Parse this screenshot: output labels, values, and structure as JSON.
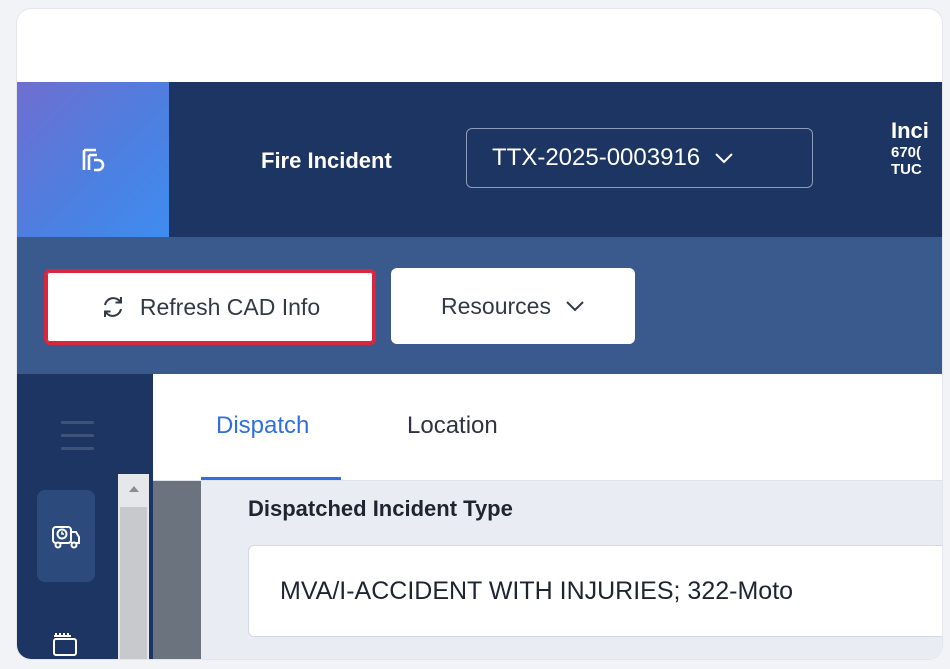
{
  "header": {
    "page_title": "Fire Incident",
    "incident_number": "TTX-2025-0003916",
    "incident_info": {
      "line1": "Inci",
      "line2": "670(",
      "line3": "TUC"
    }
  },
  "toolbar": {
    "refresh_label": "Refresh CAD Info",
    "resources_label": "Resources"
  },
  "tabs": {
    "dispatch": "Dispatch",
    "location": "Location"
  },
  "form": {
    "dispatched_type_label": "Dispatched Incident Type",
    "dispatched_type_value": "MVA/I-ACCIDENT WITH INJURIES; 322-Moto"
  },
  "colors": {
    "topbar": "#1d3563",
    "toolbar": "#3a5a8d",
    "highlight": "#d7263d",
    "active_tab": "#2f6fe0"
  },
  "icons": {
    "logo": "app-logo-icon",
    "refresh": "refresh-icon",
    "nav": "ambulance-clock-icon"
  }
}
